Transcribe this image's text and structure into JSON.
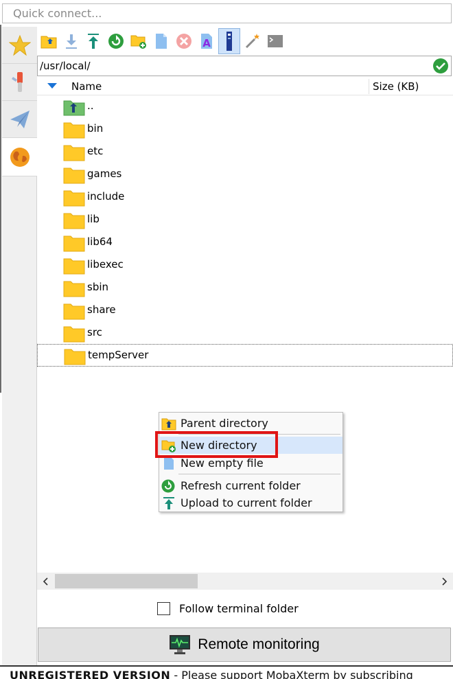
{
  "quick_connect": {
    "placeholder": "Quick connect..."
  },
  "path": {
    "value": "/usr/local/"
  },
  "columns": {
    "name": "Name",
    "size": "Size (KB)"
  },
  "files": [
    {
      "name": "..",
      "type": "parent"
    },
    {
      "name": "bin",
      "type": "folder"
    },
    {
      "name": "etc",
      "type": "folder"
    },
    {
      "name": "games",
      "type": "folder"
    },
    {
      "name": "include",
      "type": "folder"
    },
    {
      "name": "lib",
      "type": "folder"
    },
    {
      "name": "lib64",
      "type": "folder"
    },
    {
      "name": "libexec",
      "type": "folder"
    },
    {
      "name": "sbin",
      "type": "folder"
    },
    {
      "name": "share",
      "type": "folder"
    },
    {
      "name": "src",
      "type": "folder"
    },
    {
      "name": "tempServer",
      "type": "folder"
    }
  ],
  "context_menu": {
    "parent_directory": "Parent directory",
    "new_directory": "New directory",
    "new_empty_file": "New empty file",
    "refresh": "Refresh current folder",
    "upload": "Upload to current folder"
  },
  "follow_terminal": {
    "label": "Follow terminal folder",
    "checked": false
  },
  "remote_monitoring": {
    "label": "Remote monitoring"
  },
  "status": {
    "unregistered": "UNREGISTERED VERSION",
    "message": " -  Please support MobaXterm by subscribing"
  },
  "colors": {
    "folder": "#ffc928",
    "accent_green": "#2e9e3e",
    "highlight_red": "#e01515",
    "menu_hover": "#d7e7fb"
  }
}
